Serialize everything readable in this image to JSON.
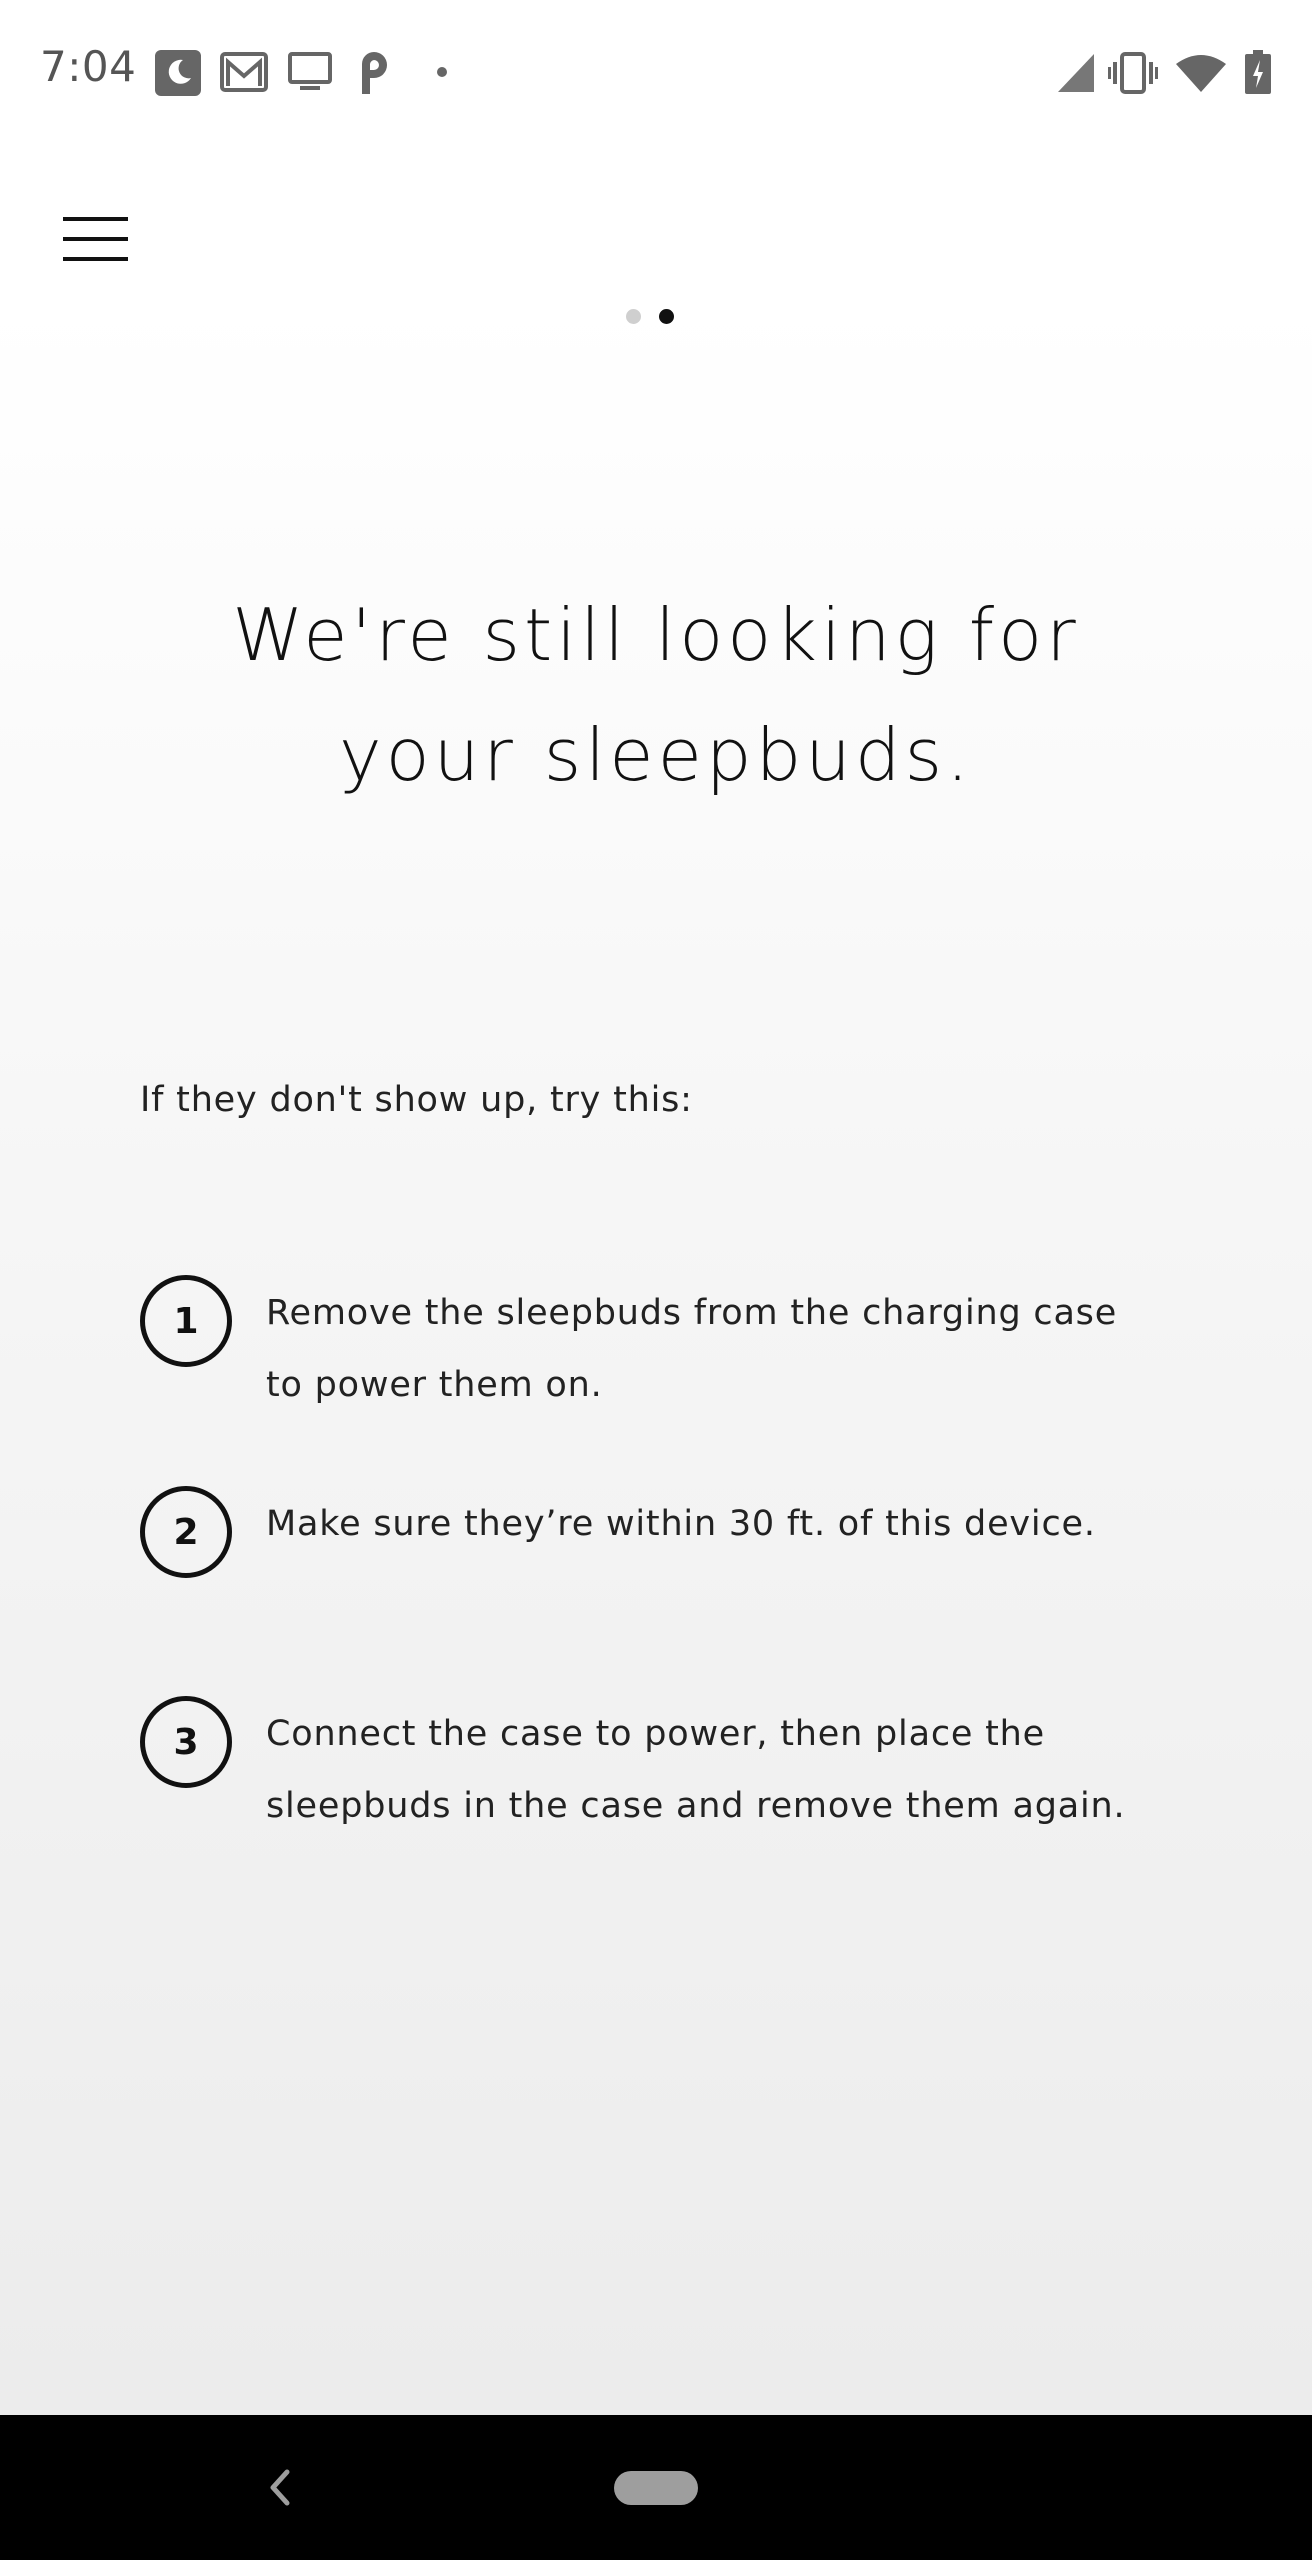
{
  "status_bar": {
    "time": "7:04",
    "left_icons": [
      "do-not-disturb-icon",
      "gmail-icon",
      "cast-screen-icon",
      "p-app-icon",
      "dot-icon"
    ],
    "right_icons": [
      "signal-icon",
      "vibrate-icon",
      "wifi-icon",
      "battery-icon"
    ]
  },
  "header": {
    "menu_icon": "hamburger-menu-icon",
    "pager": {
      "count": 2,
      "active_index": 1
    }
  },
  "main": {
    "headline_line1": "We're still looking for",
    "headline_line2": "your sleepbuds.",
    "intro": "If they don't show up, try this:",
    "steps": [
      {
        "number": "1",
        "text_line1": "Remove the sleepbuds from the charging case",
        "text_line2": "to power them on."
      },
      {
        "number": "2",
        "text_line1": "Make sure they’re within 30 ft. of this device.",
        "text_line2": ""
      },
      {
        "number": "3",
        "text_line1": "Connect the case to power, then place the",
        "text_line2": "sleepbuds in the case and remove them again."
      }
    ]
  },
  "nav_bar": {
    "back_icon": "back-chevron-icon",
    "home_icon": "home-pill-icon"
  },
  "colors": {
    "text": "#111111",
    "status_icons": "#666666",
    "nav_background": "#000000",
    "pager_inactive": "#cfcfcf"
  }
}
